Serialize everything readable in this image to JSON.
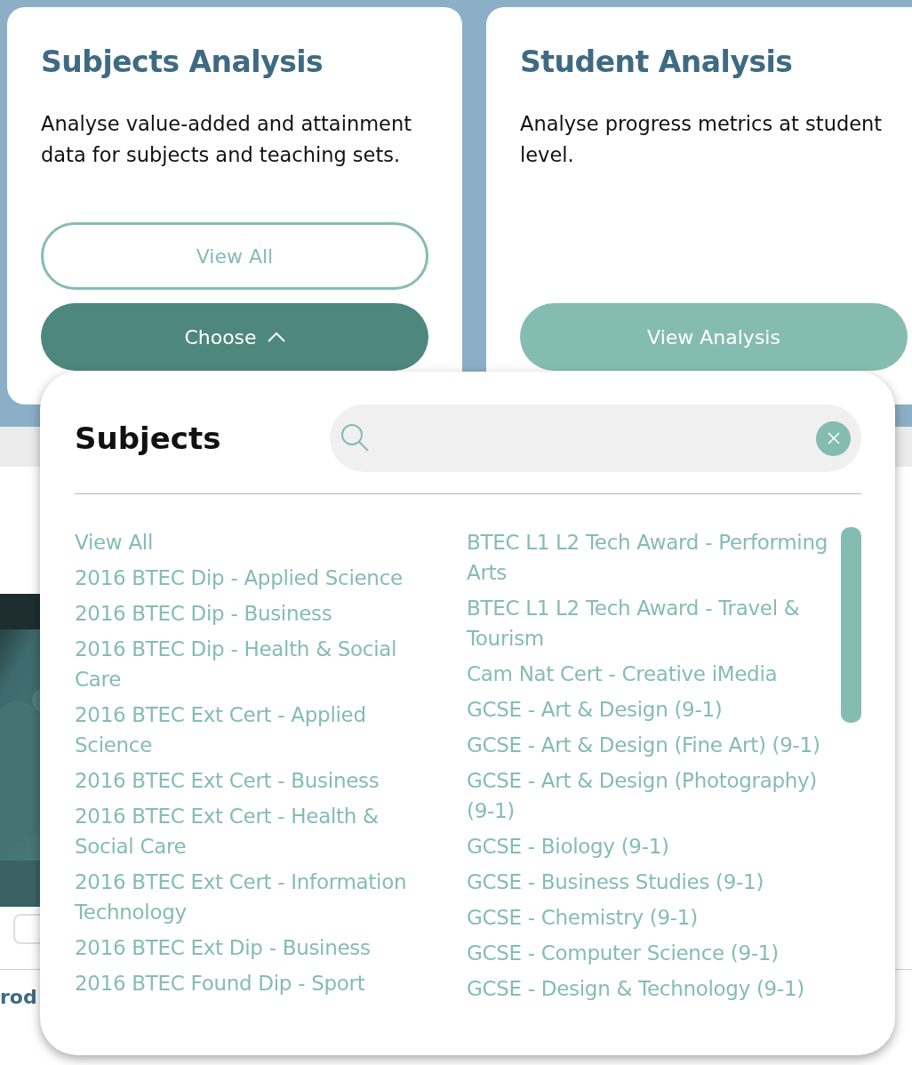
{
  "cards": [
    {
      "title": "Subjects Analysis",
      "description": "Analyse value-added and attainment data for subjects and teaching sets.",
      "buttons": [
        {
          "label": "View All",
          "kind": "outline"
        },
        {
          "label": "Choose",
          "kind": "filled",
          "expanded": true
        }
      ]
    },
    {
      "title": "Student Analysis",
      "description": "Analyse progress metrics at student level.",
      "buttons": [
        {
          "label": "View Analysis",
          "kind": "light"
        }
      ]
    }
  ],
  "background": {
    "heading": "rod"
  },
  "dropdown": {
    "title": "Subjects",
    "search": {
      "kind": "empty"
    },
    "columns": [
      [
        "View All",
        "2016 BTEC Dip - Applied Science",
        "2016 BTEC Dip - Business",
        "2016 BTEC Dip - Health & Social Care",
        "2016 BTEC Ext Cert - Applied Science",
        "2016 BTEC Ext Cert - Business",
        "2016 BTEC Ext Cert - Health & Social Care",
        "2016 BTEC Ext Cert - Information Technology",
        "2016 BTEC Ext Dip - Business",
        "2016 BTEC Found Dip - Sport"
      ],
      [
        "BTEC L1 L2 Tech Award - Performing Arts",
        "BTEC L1 L2 Tech Award - Travel & Tourism",
        "Cam Nat Cert - Creative iMedia",
        "GCSE - Art & Design (9-1)",
        "GCSE - Art & Design (Fine Art) (9-1)",
        "GCSE - Art & Design (Photography) (9-1)",
        "GCSE - Biology (9-1)",
        "GCSE - Business Studies (9-1)",
        "GCSE - Chemistry (9-1)",
        "GCSE - Computer Science (9-1)",
        "GCSE - Design & Technology (9-1)"
      ]
    ]
  }
}
